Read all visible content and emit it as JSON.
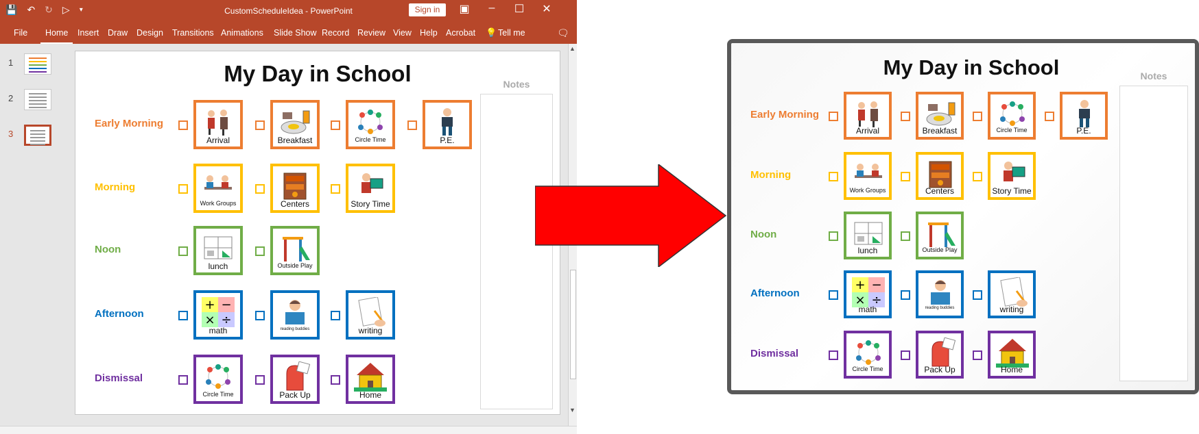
{
  "window": {
    "doc_title": "CustomScheduleIdea  -  PowerPoint",
    "sign_in": "Sign in",
    "tabs": [
      "File",
      "Home",
      "Insert",
      "Draw",
      "Design",
      "Transitions",
      "Animations",
      "Slide Show",
      "Record",
      "Review",
      "View",
      "Help",
      "Acrobat",
      "Tell me"
    ],
    "active_tab": "Home",
    "slides": [
      "1",
      "2",
      "3"
    ],
    "selected_slide": "3"
  },
  "colors": {
    "ribbon": "#b7472a",
    "early_morning": "#ed7d31",
    "morning": "#ffc000",
    "noon": "#70ad47",
    "afternoon": "#0070c0",
    "dismissal": "#7030a0",
    "arrow": "#ff0000"
  },
  "slide": {
    "title": "My Day in School",
    "notes_label": "Notes",
    "rows": [
      {
        "label": "Early Morning",
        "color": "#ed7d31",
        "items": [
          "Arrival",
          "Breakfast",
          "Circle Time",
          "P.E."
        ]
      },
      {
        "label": "Morning",
        "color": "#ffc000",
        "items": [
          "Work Groups",
          "Centers",
          "Story Time"
        ]
      },
      {
        "label": "Noon",
        "color": "#70ad47",
        "items": [
          "lunch",
          "Outside Play"
        ]
      },
      {
        "label": "Afternoon",
        "color": "#0070c0",
        "items": [
          "math",
          "reading buddies",
          "writing"
        ]
      },
      {
        "label": "Dismissal",
        "color": "#7030a0",
        "items": [
          "Circle Time",
          "Pack Up",
          "Home"
        ]
      }
    ]
  }
}
